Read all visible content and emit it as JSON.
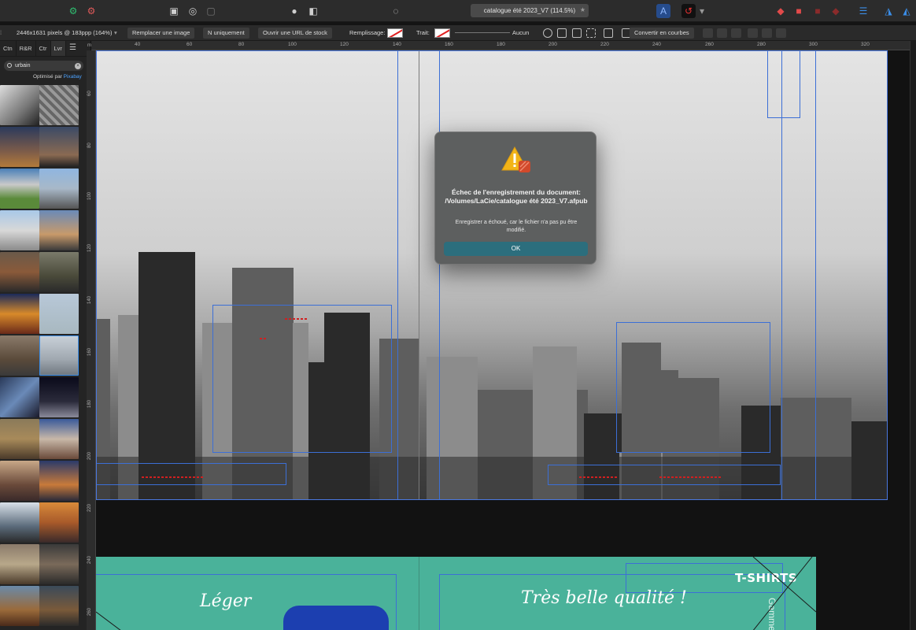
{
  "document": {
    "title": "catalogue été 2023_V7 (114.5%)",
    "favorite_icon": "star-icon"
  },
  "toolbar": {
    "icons": [
      "persona-publisher-icon",
      "persona-photo-icon",
      "frame-tool-icon",
      "shape-tool-icon",
      "view-icon",
      "pin-icon",
      "preflight-icon",
      "eye-icon",
      "text-frame-icon",
      "snapping-icon",
      "arrange-icon",
      "boolean-add-icon",
      "boolean-subtract-icon",
      "boolean-intersect-icon",
      "align-icon",
      "flip-icon"
    ]
  },
  "context": {
    "image_info": "2446x1631 pixels @ 183ppp (164%)",
    "replace_image": "Remplacer une image",
    "bw_only": "N uniquement",
    "open_stock_url": "Ouvrir une URL de stock",
    "fill_label": "Remplissage:",
    "stroke_label": "Trait:",
    "stroke_value": "Aucun",
    "convert_curves": "Convertir en courbes"
  },
  "panel": {
    "tabs": [
      "Ctn",
      "R&R",
      "Ctr",
      "Lvr"
    ],
    "menu_icon": "hamburger-menu-icon",
    "search_value": "urbain",
    "powered_by_prefix": "Optimisé par",
    "powered_by_brand": "Pixabay"
  },
  "ruler": {
    "unit": "mm",
    "top_labels": [
      "40",
      "60",
      "80",
      "100",
      "120",
      "140",
      "160",
      "180",
      "200",
      "220",
      "240",
      "260",
      "280",
      "300",
      "320"
    ],
    "left_labels": [
      "60",
      "80",
      "100",
      "120",
      "140",
      "160",
      "180",
      "200",
      "220",
      "240",
      "260"
    ]
  },
  "page2": {
    "leger": "Léger",
    "belle_qualite": "Très belle qualité !",
    "tshirts": "T-SHIRTS",
    "gamme": "Gamme"
  },
  "dialog": {
    "title": "Échec de l'enregistrement du document: /Volumes/LaCie/catalogue été 2023_V7.afpub",
    "message": "Enregistrer a échoué, car le fichier n'a pas pu être modifié.",
    "ok_label": "OK",
    "icon": "warning-icon"
  },
  "colors": {
    "accent_blue": "#3c6fd6",
    "dialog_button": "#2c6e7d",
    "teal_page": "#4ab29a"
  }
}
